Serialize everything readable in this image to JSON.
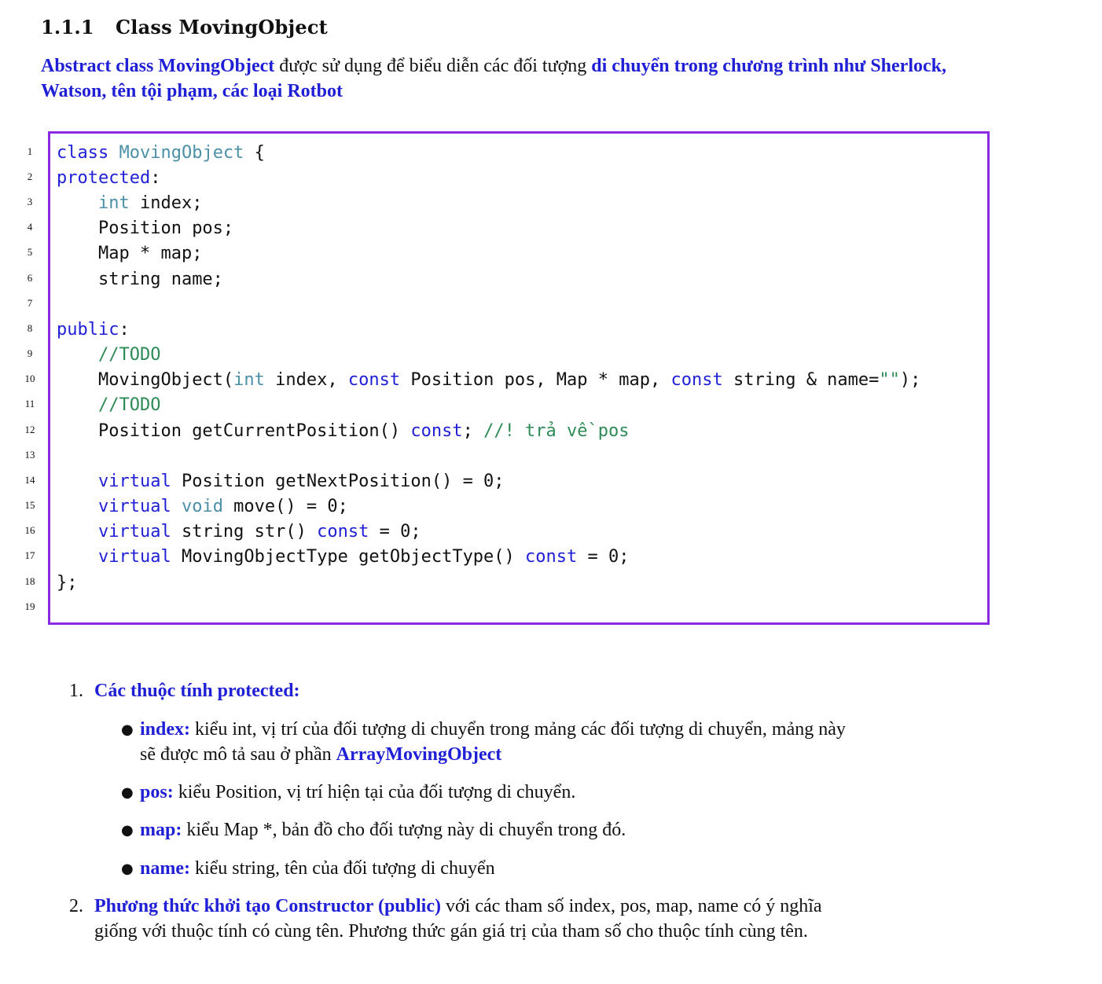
{
  "heading": {
    "number": "1.1.1",
    "title": "Class MovingObject"
  },
  "intro": {
    "lead": "Abstract class MovingObject",
    "middle": " được sử dụng để biểu diễn các đối tượng ",
    "tail": "di chuyển trong chương trình như Sherlock, Watson, tên tội phạm, các loại Rotbot"
  },
  "code": {
    "line_numbers": [
      "1",
      "2",
      "3",
      "4",
      "5",
      "6",
      "7",
      "8",
      "9",
      "10",
      "11",
      "12",
      "13",
      "14",
      "15",
      "16",
      "17",
      "18",
      "19"
    ],
    "l1_kw": "class",
    "l1_type": "MovingObject",
    "l1_rest": " {",
    "l2_kw": "protected",
    "l2_rest": ":",
    "l3_type": "int",
    "l3_rest": " index;",
    "l4": "Position pos;",
    "l5": "Map * map;",
    "l6": "string name;",
    "l8_kw": "public",
    "l8_rest": ":",
    "l9": "//TODO",
    "l10_a": "MovingObject(",
    "l10_int": "int",
    "l10_b": " index, ",
    "l10_const1": "const",
    "l10_c": " Position pos, Map * map, ",
    "l10_const2": "const",
    "l10_d": " string & name=",
    "l10_str": "\"\"",
    "l10_e": ");",
    "l11": "//TODO",
    "l12_a": "Position getCurrentPosition() ",
    "l12_const": "const",
    "l12_b": "; ",
    "l12_cm": "//! trả về pos",
    "l14_kw": "virtual",
    "l14_rest": " Position getNextPosition() = 0;",
    "l15_kw": "virtual",
    "l15_type": "void",
    "l15_rest": " move() = 0;",
    "l16_kw": "virtual",
    "l16_a": " string str() ",
    "l16_const": "const",
    "l16_b": " = 0;",
    "l17_kw": "virtual",
    "l17_a": " MovingObjectType getObjectType() ",
    "l17_const": "const",
    "l17_b": " = 0;",
    "l18": "};"
  },
  "list": {
    "item1_num": "1.",
    "item1_title": "Các thuộc tính protected:",
    "bullets": [
      {
        "label": "index:",
        "text": " kiểu int, vị trí của đối tượng di chuyển trong mảng các đối tượng di chuyển, mảng này",
        "text2": "sẽ được mô tả sau ở phần ",
        "link": "ArrayMovingObject"
      },
      {
        "label": "pos:",
        "text": " kiểu Position, vị trí hiện tại của đối tượng di chuyển."
      },
      {
        "label": "map:",
        "text": " kiểu Map *, bản đồ cho đối tượng này di chuyển trong đó."
      },
      {
        "label": "name:",
        "text": " kiểu string, tên của đối tượng di chuyển"
      }
    ],
    "item2_num": "2.",
    "item2_title": "Phương thức khởi tạo Constructor (public)",
    "item2_text": " với các tham số index, pos, map, name có ý nghĩa",
    "item2_text2": "giống với thuộc tính có cùng tên. Phương thức gán giá trị của tham số cho thuộc tính cùng tên."
  }
}
